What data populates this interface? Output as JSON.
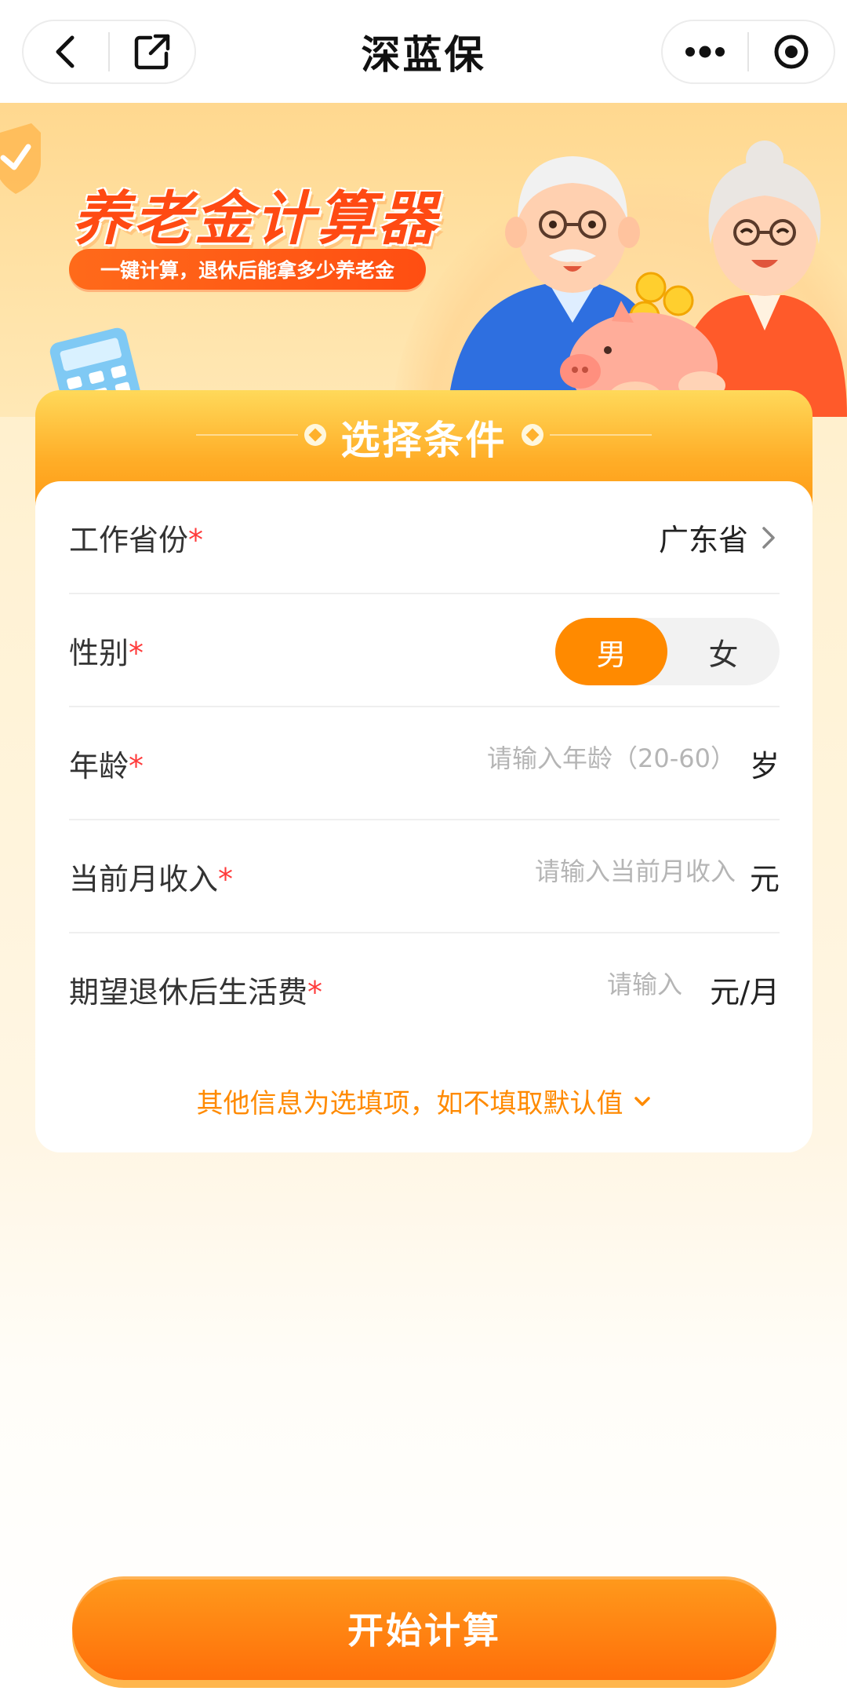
{
  "navbar": {
    "title": "深蓝保",
    "back_icon": "chevron-left-icon",
    "share_icon": "external-link-icon",
    "more_icon": "more-dots-icon",
    "close_icon": "target-circle-icon"
  },
  "banner": {
    "title": "养老金计算器",
    "subtitle": "一键计算，退休后能拿多少养老金"
  },
  "card": {
    "header_title": "选择条件"
  },
  "form": {
    "province": {
      "label": "工作省份",
      "required_mark": "*",
      "value": "广东省"
    },
    "gender": {
      "label": "性别",
      "required_mark": "*",
      "options": [
        "男",
        "女"
      ],
      "selected": "男"
    },
    "age": {
      "label": "年龄",
      "required_mark": "*",
      "placeholder": "请输入年龄（20-60）",
      "unit": "岁"
    },
    "income": {
      "label": "当前月收入",
      "required_mark": "*",
      "placeholder": "请输入当前月收入",
      "unit": "元"
    },
    "living_cost": {
      "label": "期望退休后生活费",
      "required_mark": "*",
      "placeholder": "请输入",
      "unit": "元/月"
    },
    "optional_note": "其他信息为选填项，如不填取默认值"
  },
  "actions": {
    "start_label": "开始计算"
  },
  "colors": {
    "accent": "#ff8a00",
    "required": "#ff3b3b",
    "banner_title": "#ff4a13"
  }
}
